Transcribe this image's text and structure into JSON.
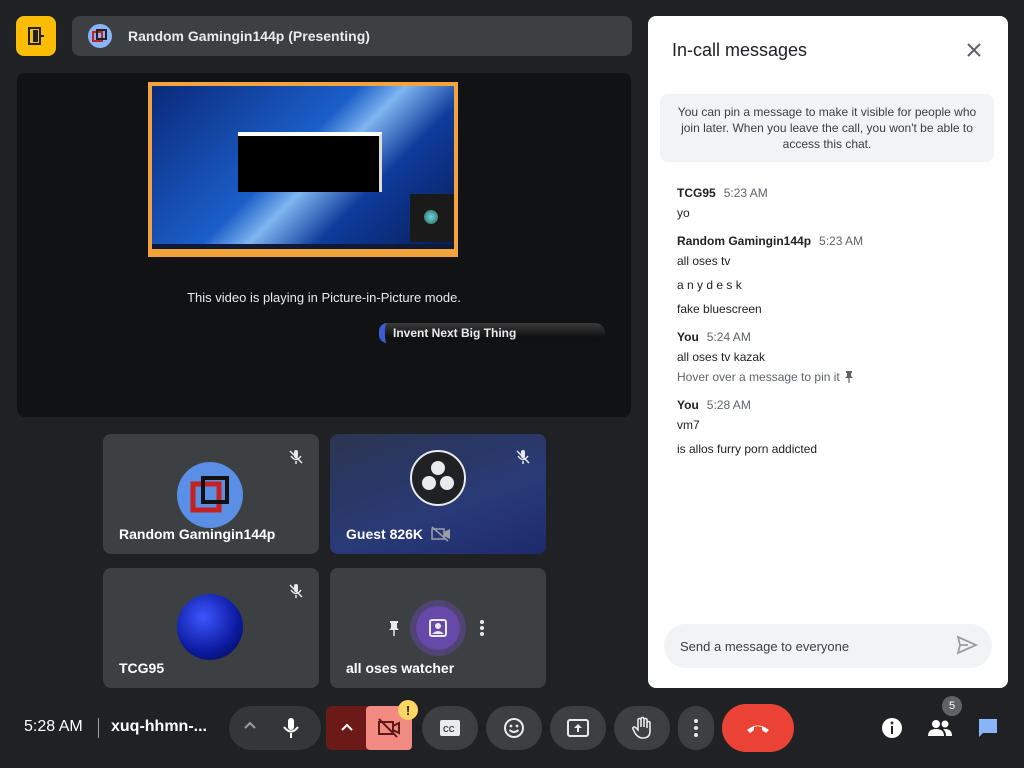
{
  "presenter": {
    "title": "Random Gamingin144p (Presenting)"
  },
  "stage": {
    "pip_message": "This video is playing in Picture-in-Picture mode.",
    "banner_text": "Invent Next Big Thing"
  },
  "tiles": [
    {
      "name": "Random Gamingin144p",
      "muted": true
    },
    {
      "name": "Guest 826K",
      "muted": true,
      "camera_off": true
    },
    {
      "name": "TCG95",
      "muted": true
    },
    {
      "name": "all oses watcher"
    }
  ],
  "chat": {
    "title": "In-call messages",
    "notice": "You can pin a message to make it visible for people who join later. When you leave the call, you won't be able to access this chat.",
    "messages": [
      {
        "sender": "TCG95",
        "time": "5:23 AM",
        "lines": [
          "yo"
        ]
      },
      {
        "sender": "Random Gamingin144p",
        "time": "5:23 AM",
        "lines": [
          "all oses tv",
          "a n y d e s k",
          "fake bluescreen"
        ]
      },
      {
        "sender": "You",
        "time": "5:24 AM",
        "lines": [
          "all oses tv kazak"
        ],
        "hint": "Hover over a message to pin it"
      },
      {
        "sender": "You",
        "time": "5:28 AM",
        "lines": [
          "vm7",
          "is allos furry porn addicted"
        ]
      }
    ],
    "input_placeholder": "Send a message to everyone"
  },
  "bottom_bar": {
    "time": "5:28 AM",
    "meeting_code": "xuq-hhmn-...",
    "warning_badge": "!",
    "participant_count": "5"
  },
  "colors": {
    "background": "#202124",
    "tile": "#3c4043",
    "end_call": "#ea4335",
    "camera_off": "#f28b82",
    "accent_yellow": "#fbbc04",
    "chat_icon": "#8ab4f8"
  }
}
